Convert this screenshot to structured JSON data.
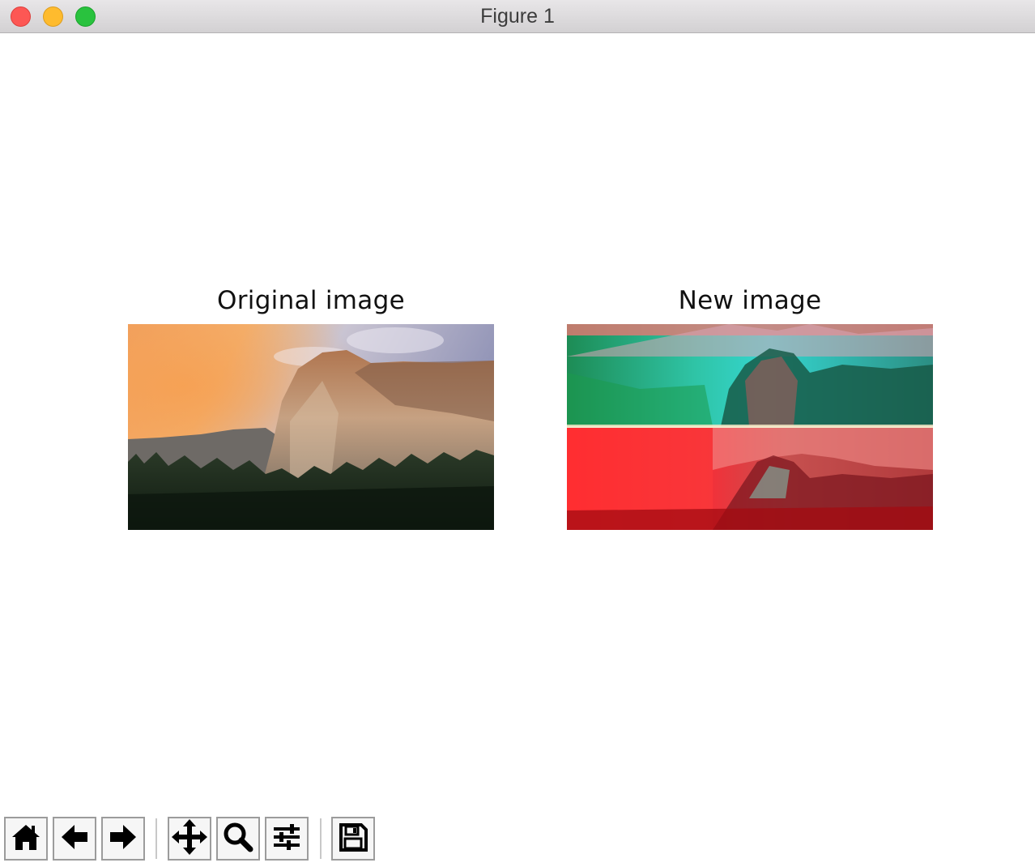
{
  "window": {
    "title": "Figure 1"
  },
  "figure": {
    "axes": [
      {
        "title": "Original image",
        "image": "El Capitan cliff at sunset, orange clouds, pine forest"
      },
      {
        "title": "New image",
        "image": "Channel-shifted El Capitan with cyan/green and red tints"
      }
    ]
  },
  "toolbar": {
    "buttons": [
      {
        "name": "home",
        "icon": "home-icon"
      },
      {
        "name": "back",
        "icon": "arrow-left-icon"
      },
      {
        "name": "forward",
        "icon": "arrow-right-icon"
      },
      {
        "name": "pan",
        "icon": "move-icon"
      },
      {
        "name": "zoom",
        "icon": "magnifier-icon"
      },
      {
        "name": "configure-subplots",
        "icon": "sliders-icon"
      },
      {
        "name": "save",
        "icon": "floppy-disk-icon"
      }
    ]
  },
  "colors": {
    "close": "#fd5754",
    "minimize": "#febb2e",
    "maximize": "#29c23e"
  }
}
